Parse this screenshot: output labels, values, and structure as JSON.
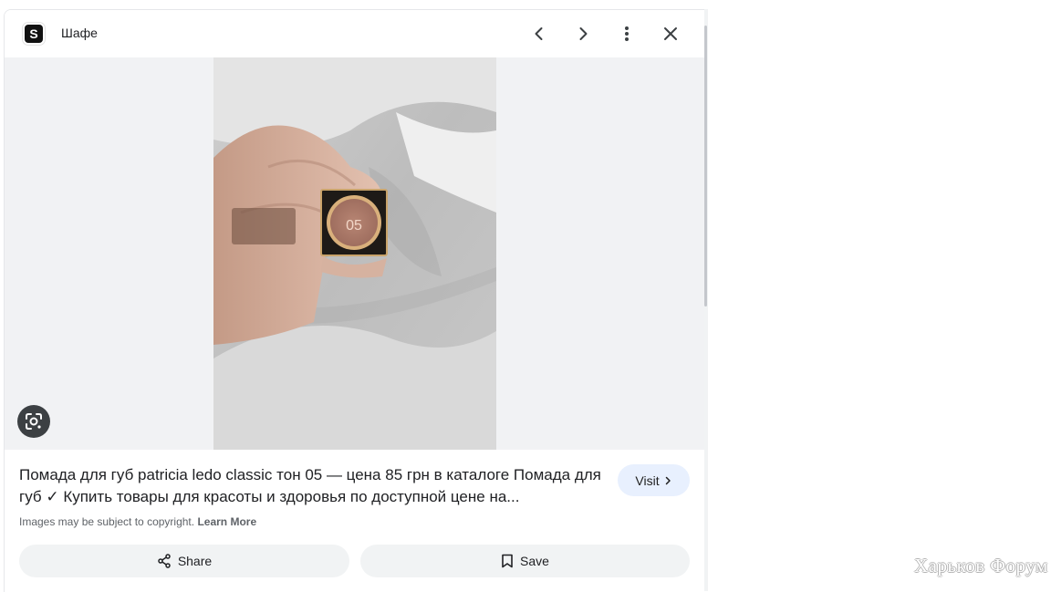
{
  "header": {
    "favicon_letter": "S",
    "site_name": "Шафе",
    "prev_icon": "chevron-left-icon",
    "next_icon": "chevron-right-icon",
    "more_icon": "more-vert-icon",
    "close_icon": "close-icon"
  },
  "image": {
    "lipstick_shade_text": "05",
    "lens_icon": "google-lens-icon"
  },
  "result": {
    "title": "Помада для губ patricia ledo classic тон 05 — цена 85 грн в каталоге Помада для губ ✓ Купить товары для красоты и здоровья по доступной цене на...",
    "visit_label": "Visit",
    "copyright_text": "Images may be subject to copyright.",
    "learn_more_label": "Learn More"
  },
  "actions": {
    "share_label": "Share",
    "save_label": "Save"
  },
  "watermark": {
    "text": "Харьков Форум"
  },
  "colors": {
    "image_background": "#f1f2f4",
    "visit_button": "#e8f0fe",
    "action_button": "#f1f3f4",
    "lens_button": "#3c4043"
  }
}
